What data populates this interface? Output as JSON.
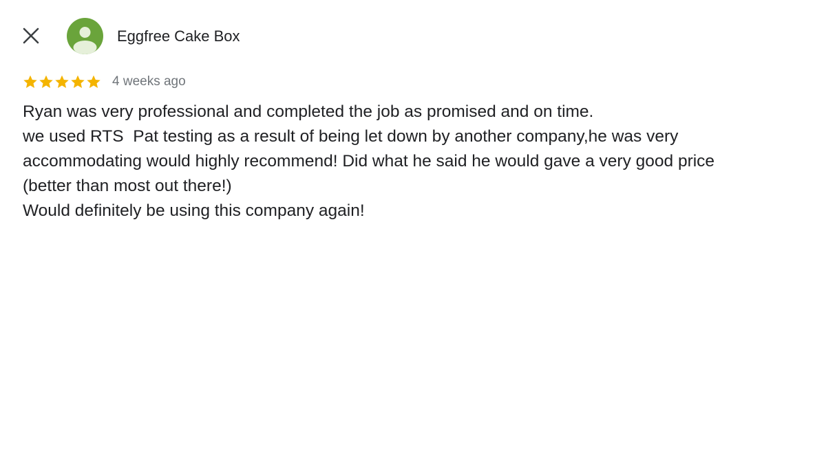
{
  "header": {
    "close_icon": "close-icon",
    "avatar_icon": "person-icon",
    "avatar_color": "#6aa43b",
    "author_name": "Eggfree Cake Box"
  },
  "review": {
    "rating": 5,
    "rating_max": 5,
    "star_color": "#f4b400",
    "time_ago": "4 weeks ago",
    "lines": [
      "Ryan was very professional and completed the job as promised and on time.",
      "we used RTS  Pat testing as a result of being let down by another company,he was very",
      "accommodating would highly recommend! Did what he said he would gave a very good price",
      "(better than most out there!)",
      "Would definitely be using this company again!"
    ]
  }
}
